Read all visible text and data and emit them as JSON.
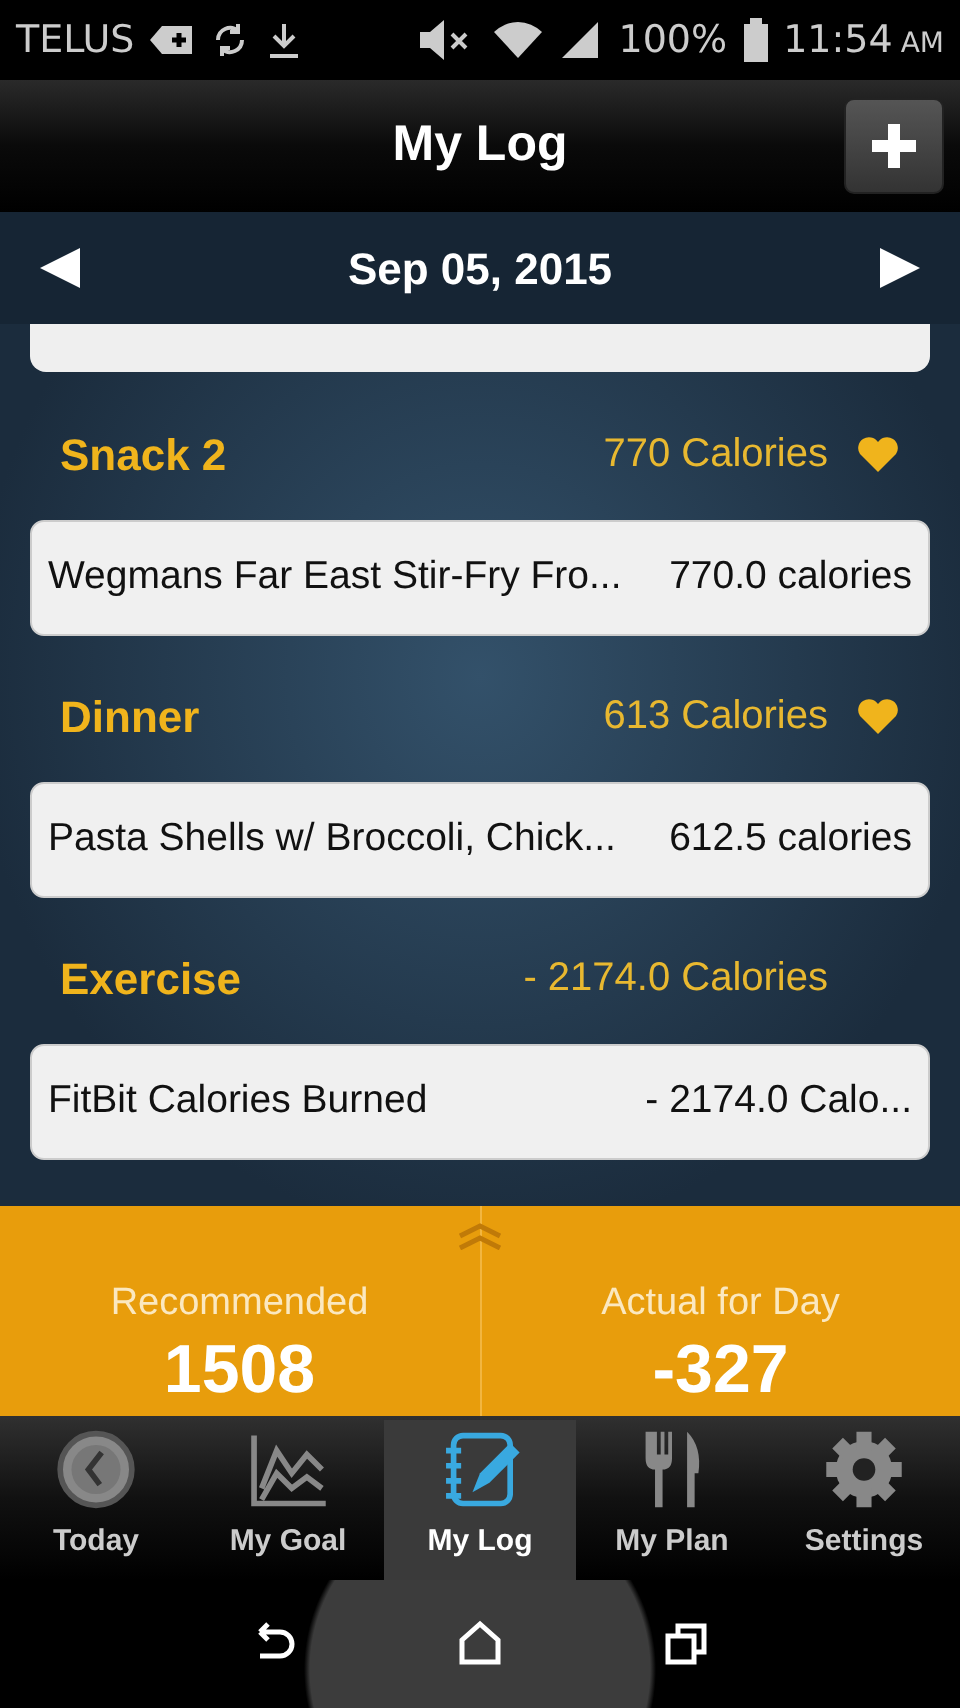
{
  "status_bar": {
    "carrier": "TELUS",
    "battery": "100%",
    "time": "11:54",
    "ampm": "AM"
  },
  "header": {
    "title": "My Log"
  },
  "date_bar": {
    "date": "Sep 05, 2015"
  },
  "sections": [
    {
      "name": "Snack 2",
      "total": "770 Calories",
      "favorite": true,
      "entries": [
        {
          "food": "Wegmans Far East Stir-Fry Fro...",
          "calories": "770.0 calories"
        }
      ]
    },
    {
      "name": "Dinner",
      "total": "613 Calories",
      "favorite": true,
      "entries": [
        {
          "food": "Pasta Shells w/ Broccoli, Chick...",
          "calories": "612.5 calories"
        }
      ]
    },
    {
      "name": "Exercise",
      "total": "- 2174.0 Calories",
      "favorite": false,
      "entries": [
        {
          "food": "FitBit Calories Burned",
          "calories": "- 2174.0 Calo..."
        }
      ]
    }
  ],
  "summary": [
    {
      "label": "Recommended",
      "value": "1508"
    },
    {
      "label": "Actual for Day",
      "value": "-327"
    }
  ],
  "tabs": [
    {
      "kind": "clock",
      "label": "Today",
      "selected": false
    },
    {
      "kind": "chart",
      "label": "My Goal",
      "selected": false
    },
    {
      "kind": "notebook",
      "label": "My Log",
      "selected": true
    },
    {
      "kind": "cutlery",
      "label": "My Plan",
      "selected": false
    },
    {
      "kind": "gear",
      "label": "Settings",
      "selected": false
    }
  ]
}
